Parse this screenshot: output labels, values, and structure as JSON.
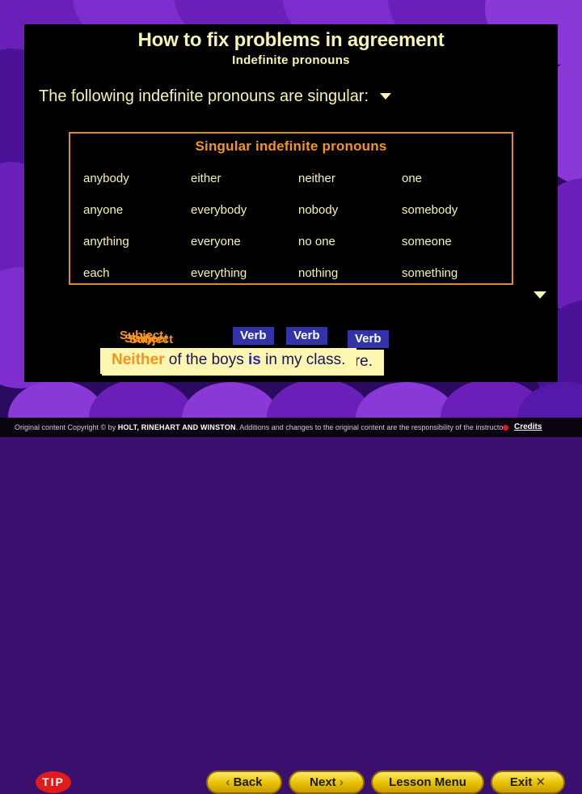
{
  "slide": {
    "title": "How to fix problems in agreement",
    "subtitle": "Indefinite pronouns",
    "lead": "The following indefinite pronouns are singular:"
  },
  "table": {
    "heading": "Singular indefinite pronouns",
    "columns": [
      [
        "anybody",
        "anyone",
        "anything",
        "each"
      ],
      [
        "either",
        "everybody",
        "everyone",
        "everything"
      ],
      [
        "neither",
        "nobody",
        "no one",
        "nothing"
      ],
      [
        "one",
        "somebody",
        "someone",
        "something"
      ]
    ],
    "cells": [
      "anybody",
      "either",
      "neither",
      "one",
      "anyone",
      "everybody",
      "nobody",
      "somebody",
      "anything",
      "everyone",
      "no one",
      "someone",
      "each",
      "everything",
      "nothing",
      "something"
    ],
    "border_color": "#e08b2a",
    "heading_color": "#f5941f",
    "text_color": "#f7f3b0"
  },
  "example": {
    "subject_labels": [
      "Subject",
      "Subject",
      "Subject"
    ],
    "verb_labels": [
      "Verb",
      "Verb",
      "Verb"
    ],
    "sentence_under_tail": "ore.",
    "sentence": {
      "subject": "Neither",
      "middle": " of the boys ",
      "verb": "is",
      "tail": " in my class."
    },
    "subject_color": "#f5941f",
    "verb_box_color": "#3333a8",
    "highlight_bg": "#fdf6b0"
  },
  "toolbar": {
    "tip": "TIP",
    "back": "Back",
    "back_glyph": "‹",
    "next": "Next",
    "next_glyph": "›",
    "lesson_menu": "Lesson Menu",
    "exit": "Exit",
    "exit_glyph": "✕"
  },
  "footer": {
    "copyright_pre": "Original content Copyright © by ",
    "publisher": "HOLT, RINEHART AND WINSTON",
    "copyright_post": ". Additions and changes to the original content are the responsibility of the instructor.",
    "credits": "Credits"
  }
}
